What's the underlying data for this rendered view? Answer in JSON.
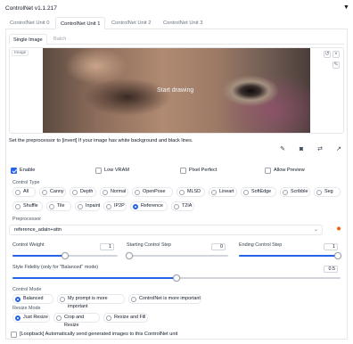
{
  "header": {
    "title": "ControlNet v1.1.217",
    "collapse_icon": "triangle-down-icon"
  },
  "tabs": [
    {
      "label": "ControlNet Unit 0",
      "active": false
    },
    {
      "label": "ControlNet Unit 1",
      "active": true
    },
    {
      "label": "ControlNet Unit 2",
      "active": false
    },
    {
      "label": "ControlNet Unit 3",
      "active": false
    }
  ],
  "subtabs": [
    {
      "label": "Single Image",
      "active": true
    },
    {
      "label": "Batch",
      "active": false
    }
  ],
  "image": {
    "label": "Image",
    "overlay_text": "Start drawing",
    "tools": [
      "undo-icon",
      "close-icon",
      "brush-icon"
    ]
  },
  "hint": "Set the preprocessor to [invert] If your image has white background and black lines.",
  "action_icons": [
    "pencil-icon",
    "camera-icon",
    "swap-icon",
    "arrow-up-icon"
  ],
  "options": [
    {
      "label": "Enable",
      "checked": true
    },
    {
      "label": "Low VRAM",
      "checked": false
    },
    {
      "label": "Pixel Perfect",
      "checked": false
    },
    {
      "label": "Allow Preview",
      "checked": false
    }
  ],
  "control_type": {
    "label": "Control Type",
    "selected": "Reference",
    "row1": [
      "All",
      "Canny",
      "Depth",
      "Normal",
      "OpenPose",
      "MLSD",
      "Lineart",
      "SoftEdge",
      "Scribble",
      "Seg"
    ],
    "row2": [
      "Shuffle",
      "Tile",
      "Inpaint",
      "IP2P",
      "Reference",
      "T2IA"
    ]
  },
  "preprocessor": {
    "label": "Preprocessor",
    "value": "reference_adain+attn",
    "chevron": "chevron-down-icon",
    "run_icon": "fire-icon"
  },
  "sliders": {
    "control_weight": {
      "label": "Control Weight",
      "value": "1",
      "fraction": 0.5
    },
    "starting_step": {
      "label": "Starting Control Step",
      "value": "0",
      "fraction": 0.0
    },
    "ending_step": {
      "label": "Ending Control Step",
      "value": "1",
      "fraction": 1.0
    },
    "style_fidelity": {
      "label": "Style Fidelity (only for \"Balanced\" mode)",
      "value": "0.5",
      "fraction": 0.5
    }
  },
  "control_mode": {
    "label": "Control Mode",
    "selected": "Balanced",
    "options": [
      "Balanced",
      "My prompt is more important",
      "ControlNet is more important"
    ]
  },
  "resize_mode": {
    "label": "Resize Mode",
    "selected": "Just Resize",
    "options": [
      "Just Resize",
      "Crop and Resize",
      "Resize and Fill"
    ]
  },
  "loopback": {
    "label": "[Loopback] Automatically send generated images to this ControlNet unit",
    "checked": false
  },
  "colors": {
    "accent": "#2563eb",
    "border": "#e5e7eb",
    "fire": "#ea580c"
  }
}
